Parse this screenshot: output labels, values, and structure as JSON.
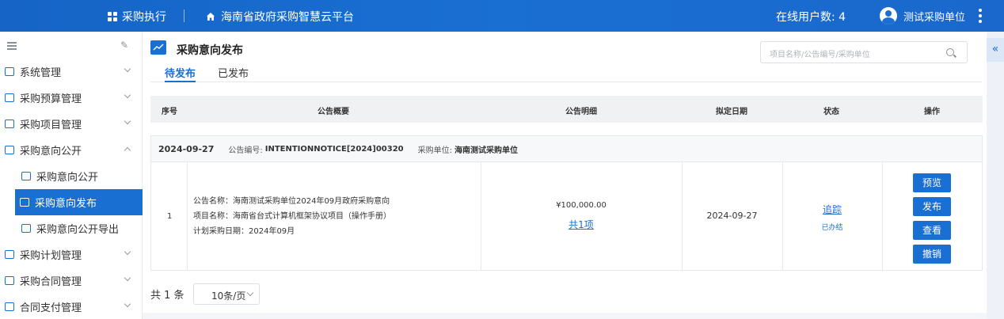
{
  "header": {
    "app_name": "采购执行",
    "platform_name": "海南省政府采购智慧云平台",
    "online_label": "在线用户数: 4",
    "user_name": "测试采购单位"
  },
  "sidebar": {
    "items": [
      {
        "label": "系统管理",
        "icon": "gear-icon"
      },
      {
        "label": "采购预算管理",
        "icon": "budget-icon"
      },
      {
        "label": "采购项目管理",
        "icon": "project-icon"
      },
      {
        "label": "采购意向公开",
        "icon": "intention-icon"
      },
      {
        "label": "采购意向公开",
        "icon": "document-icon"
      },
      {
        "label": "采购意向发布",
        "icon": "chart-icon"
      },
      {
        "label": "采购意向公开导出",
        "icon": "export-icon"
      },
      {
        "label": "采购计划管理",
        "icon": "plan-icon"
      },
      {
        "label": "采购合同管理",
        "icon": "contract-icon"
      },
      {
        "label": "合同支付管理",
        "icon": "payment-icon"
      }
    ]
  },
  "page": {
    "title": "采购意向发布",
    "search_placeholder": "项目名称/公告编号/采购单位",
    "tabs": [
      {
        "label": "待发布",
        "active": true
      },
      {
        "label": "已发布",
        "active": false
      }
    ]
  },
  "table": {
    "headers": [
      "序号",
      "公告概要",
      "公告明细",
      "拟定日期",
      "状态",
      "操作"
    ],
    "group": {
      "date": "2024-09-27",
      "notice_no_label": "公告编号:",
      "notice_no": "INTENTIONNOTICE[2024]00320",
      "unit_label": "采购单位:",
      "unit": "海南测试采购单位"
    },
    "row": {
      "index": "1",
      "summary": [
        "公告名称：海南测试采购单位2024年09月政府采购意向",
        "项目名称：海南省台式计算机框架协议项目（操作手册）",
        "计划采购日期：2024年09月"
      ],
      "amount": "¥100,000.00",
      "items_link": "共1项",
      "date": "2024-09-27",
      "track_link": "追踪",
      "status": "已办结",
      "actions": [
        "预览",
        "发布",
        "查看",
        "撤销"
      ]
    }
  },
  "pager": {
    "total": "共 1 条",
    "page_size": "10条/页"
  },
  "colors": {
    "primary": "#1a6fd3",
    "header_bg": "#1564c6"
  }
}
